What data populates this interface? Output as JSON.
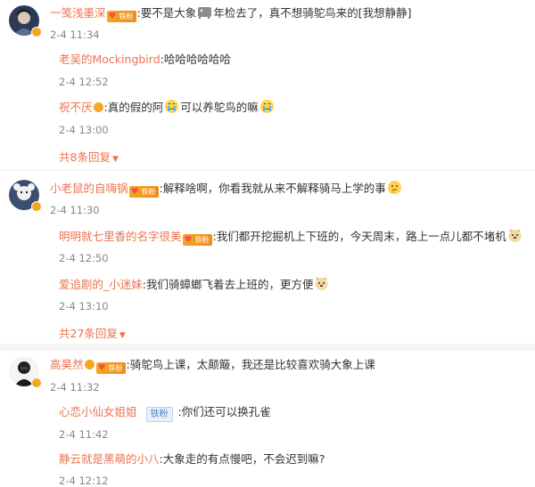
{
  "comments": [
    {
      "user": "一笺浅墨深",
      "text": ":要不是大象",
      "text2": "年检去了，真不想骑鸵鸟来的[我想静静]",
      "time": "2-4 11:34",
      "replies": [
        {
          "user": "老吴的Mockingbird",
          "text": ":哈哈哈哈哈哈",
          "time": "2-4 12:52"
        },
        {
          "user": "祝不厌",
          "text": ":真的假的阿",
          "text2": "可以养鸵鸟的嘛",
          "time": "2-4 13:00"
        }
      ],
      "more": "共8条回复"
    },
    {
      "user": "小老鼠的自嗨锅",
      "text": ":解释啥啊，你看我就从来不解释骑马上学的事",
      "time": "2-4 11:30",
      "replies": [
        {
          "user": "明明就七里香的名字很美",
          "text": ":我们都开挖掘机上下班的，今天周末，路上一点儿都不堵机",
          "time": "2-4 12:50"
        },
        {
          "user": "爱追剧的_小迷妹",
          "text": ":我们骑蟑螂飞着去上班的，更方便",
          "time": "2-4 13:10"
        }
      ],
      "more": "共27条回复"
    },
    {
      "user": "高昊然",
      "text": ":骑鸵鸟上课，太颠簸，我还是比较喜欢骑大象上课",
      "time": "2-4 11:32",
      "replies": [
        {
          "user": "心恋小仙女姐姐",
          "badge": "铁粉",
          "text": ":你们还可以换孔雀",
          "time": "2-4 11:42"
        },
        {
          "user": "静云就是黑萌的小八",
          "text": ":大象走的有点慢吧，不会迟到嘛?",
          "time": "2-4 12:12"
        }
      ]
    }
  ],
  "fan_badge": "铁粉",
  "colors": {
    "username": "#eb7350",
    "text": "#333333",
    "time": "#888888",
    "badge": "#f5a623"
  }
}
